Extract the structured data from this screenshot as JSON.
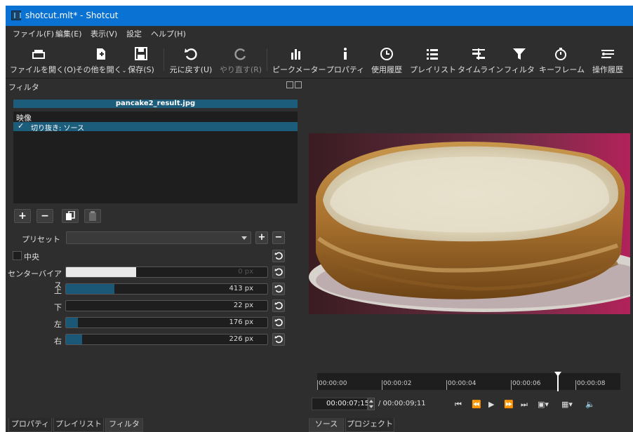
{
  "window": {
    "title": "shotcut.mlt* - Shotcut"
  },
  "menu": [
    "ファイル(F)",
    "編集(E)",
    "表示(V)",
    "設定",
    "ヘルプ(H)"
  ],
  "toolbar": {
    "open_file": "ファイルを開く(O)",
    "open_other": "その他を開く",
    "save": "保存(S)",
    "undo": "元に戻す(U)",
    "redo": "やり直す(R)",
    "peak_meter": "ピークメーター",
    "properties": "プロパティ",
    "recent": "使用履歴",
    "playlist": "プレイリスト",
    "timeline": "タイムライン",
    "filters": "フィルタ",
    "keyframes": "キーフレーム",
    "history": "操作履歴"
  },
  "filters_panel": {
    "title": "フィルタ",
    "file_name": "pancake2_result.jpg",
    "group": "映像",
    "items": [
      {
        "checked": "✓",
        "name": "切り抜き: ソース"
      }
    ],
    "preset_label": "プリセット",
    "preset_value": "",
    "center_label": "中央",
    "params": [
      {
        "label": "センターバイアス",
        "value": "0 px",
        "fill": 0.35
      },
      {
        "label": "上",
        "value": "413 px",
        "fill": 0.24
      },
      {
        "label": "下",
        "value": "22 px",
        "fill": 0.0
      },
      {
        "label": "左",
        "value": "176 px",
        "fill": 0.06
      },
      {
        "label": "右",
        "value": "226 px",
        "fill": 0.08
      }
    ]
  },
  "left_tabs": [
    "プロパティ",
    "プレイリスト",
    "フィルタ"
  ],
  "right_tabs": [
    "ソース",
    "プロジェクト"
  ],
  "timeline": {
    "ticks": [
      "00:00:00",
      "00:00:02",
      "00:00:04",
      "00:00:06",
      "00:00:08"
    ],
    "current": "00:00:07;15",
    "duration": "/ 00:00:09;11"
  }
}
